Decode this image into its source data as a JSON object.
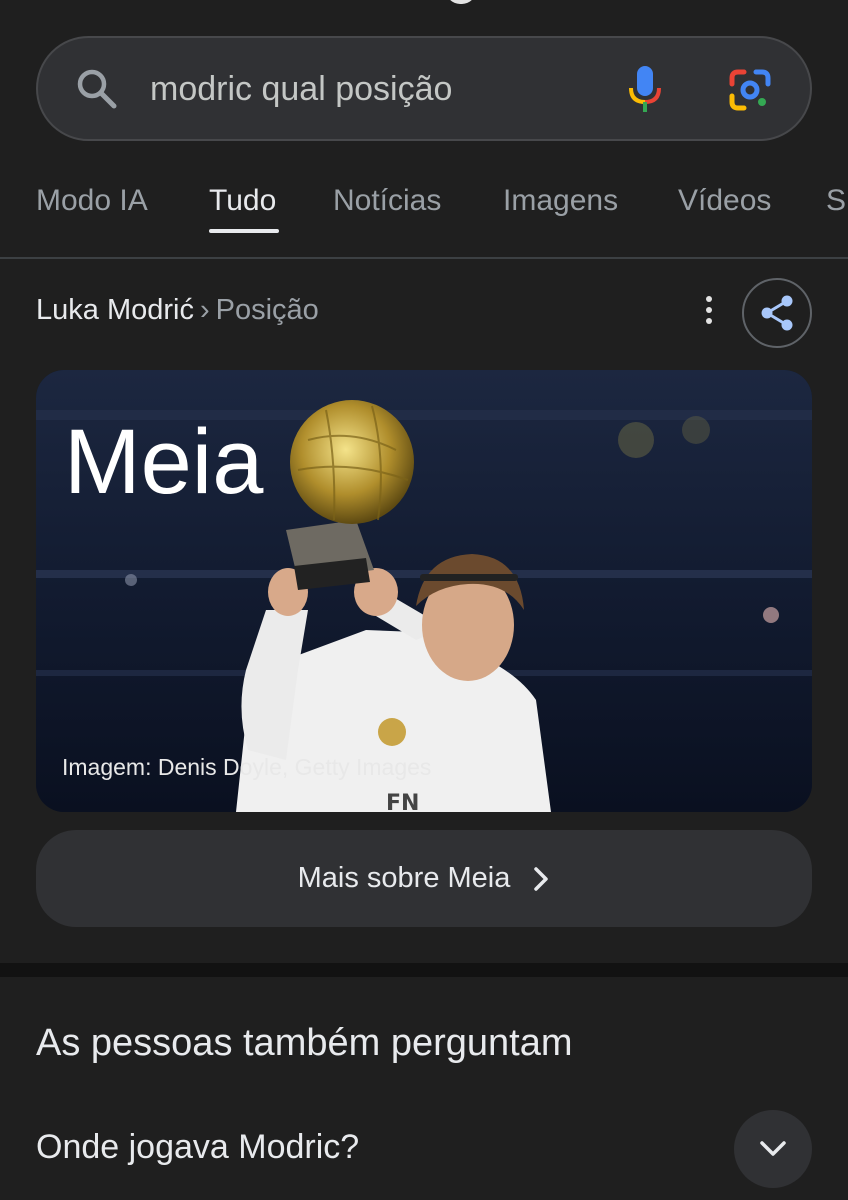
{
  "search": {
    "query": "modric qual posição"
  },
  "tabs": [
    {
      "label": "Modo IA",
      "active": false
    },
    {
      "label": "Tudo",
      "active": true
    },
    {
      "label": "Notícias",
      "active": false
    },
    {
      "label": "Imagens",
      "active": false
    },
    {
      "label": "Vídeos",
      "active": false
    },
    {
      "label": "S",
      "active": false
    }
  ],
  "breadcrumb": {
    "entity": "Luka Modrić",
    "separator": "›",
    "attribute": "Posição"
  },
  "answer": {
    "title": "Meia",
    "image_credit": "Imagem: Denis Doyle, Getty Images",
    "more_label": "Mais sobre Meia"
  },
  "people_also_ask": {
    "title": "As pessoas também perguntam",
    "questions": [
      "Onde jogava Modric?"
    ]
  },
  "colors": {
    "background": "#1f1f1f",
    "surface": "#303134",
    "text": "#e8eaed",
    "muted": "#9aa0a6",
    "google_blue": "#4285f4",
    "google_red": "#ea4335",
    "google_yellow": "#fbbc04",
    "google_green": "#34a853"
  },
  "icons": [
    "search-icon",
    "microphone-icon",
    "google-lens-icon",
    "more-vert-icon",
    "share-icon",
    "chevron-right-icon",
    "chevron-down-icon"
  ]
}
